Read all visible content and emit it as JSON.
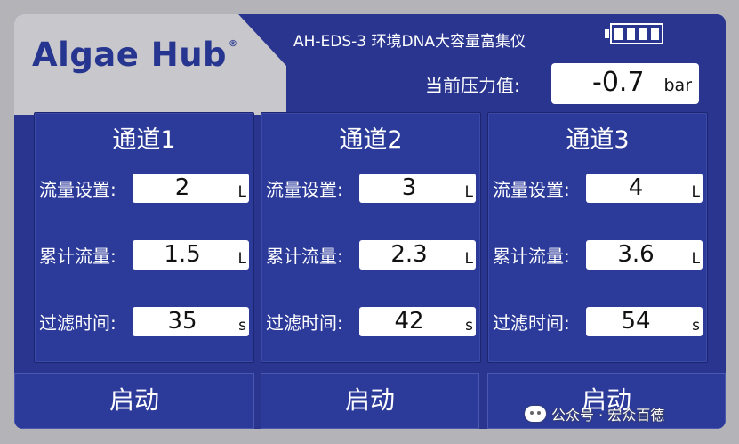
{
  "header": {
    "logo_text": "Algae Hub",
    "logo_mark": "®",
    "device_title": "AH-EDS-3 环境DNA大容量富集仪",
    "battery_icon": "battery-full-icon"
  },
  "pressure": {
    "label": "当前压力值:",
    "value": "-0.7",
    "unit": "bar"
  },
  "channels": [
    {
      "title": "通道1",
      "flow_setting": {
        "label": "流量设置:",
        "value": "2",
        "unit": "L"
      },
      "cumulative_flow": {
        "label": "累计流量:",
        "value": "1.5",
        "unit": "L"
      },
      "filter_time": {
        "label": "过滤时间:",
        "value": "35",
        "unit": "s"
      },
      "start_label": "启动"
    },
    {
      "title": "通道2",
      "flow_setting": {
        "label": "流量设置:",
        "value": "3",
        "unit": "L"
      },
      "cumulative_flow": {
        "label": "累计流量:",
        "value": "2.3",
        "unit": "L"
      },
      "filter_time": {
        "label": "过滤时间:",
        "value": "42",
        "unit": "s"
      },
      "start_label": "启动"
    },
    {
      "title": "通道3",
      "flow_setting": {
        "label": "流量设置:",
        "value": "4",
        "unit": "L"
      },
      "cumulative_flow": {
        "label": "累计流量:",
        "value": "3.6",
        "unit": "L"
      },
      "filter_time": {
        "label": "过滤时间:",
        "value": "54",
        "unit": "s"
      },
      "start_label": "启动"
    }
  ],
  "watermark": {
    "text": "公众号 · 宏众百德",
    "icon": "wechat-icon"
  },
  "colors": {
    "frame": "#2a3590",
    "panel": "#2c3a9a",
    "logo_bg": "#c8c8cc",
    "logo_text": "#26358f"
  }
}
